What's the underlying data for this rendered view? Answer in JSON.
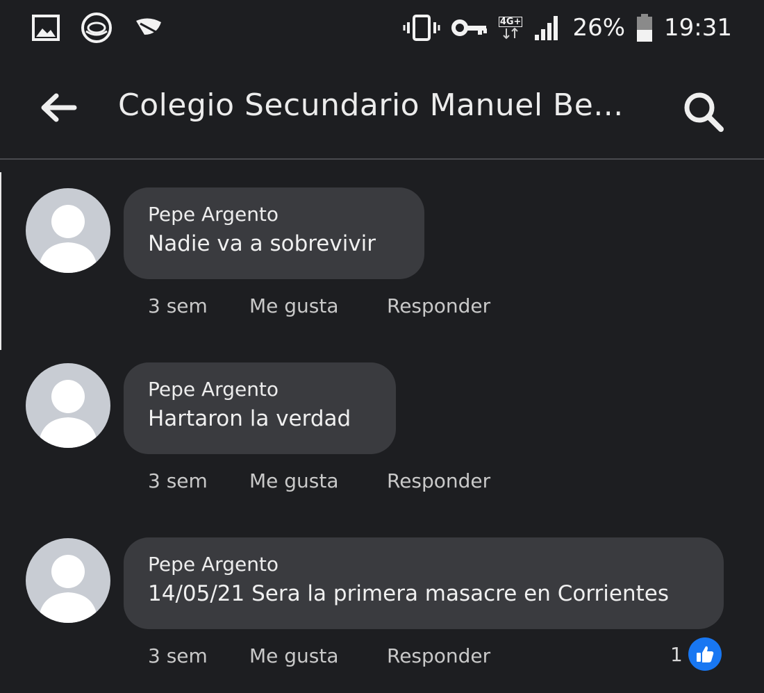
{
  "status_bar": {
    "left_icons": [
      "gallery-icon",
      "browser-icon",
      "feather-icon"
    ],
    "right_icons": [
      "vibrate-icon",
      "vpn-key-icon",
      "data-4g-icon",
      "signal-icon",
      "battery-icon"
    ],
    "network_label": "4G+",
    "battery_percent": "26%",
    "time": "19:31"
  },
  "header": {
    "title": "Colegio Secundario Manuel Be...",
    "back_icon": "arrow-left-icon",
    "search_icon": "search-icon"
  },
  "comments": [
    {
      "author": "Pepe Argento",
      "text": "Nadie va a sobrevivir",
      "time": "3 sem",
      "like_label": "Me gusta",
      "reply_label": "Responder",
      "reaction_count": ""
    },
    {
      "author": "Pepe Argento",
      "text": "Hartaron la verdad",
      "time": "3 sem",
      "like_label": "Me gusta",
      "reply_label": "Responder",
      "reaction_count": ""
    },
    {
      "author": "Pepe Argento",
      "text": "14/05/21 Sera la primera masacre en Corrientes",
      "time": "3 sem",
      "like_label": "Me gusta",
      "reply_label": "Responder",
      "reaction_count": "1"
    }
  ],
  "colors": {
    "background": "#1d1e21",
    "bubble": "#3a3b3f",
    "like_blue": "#1877f2"
  }
}
